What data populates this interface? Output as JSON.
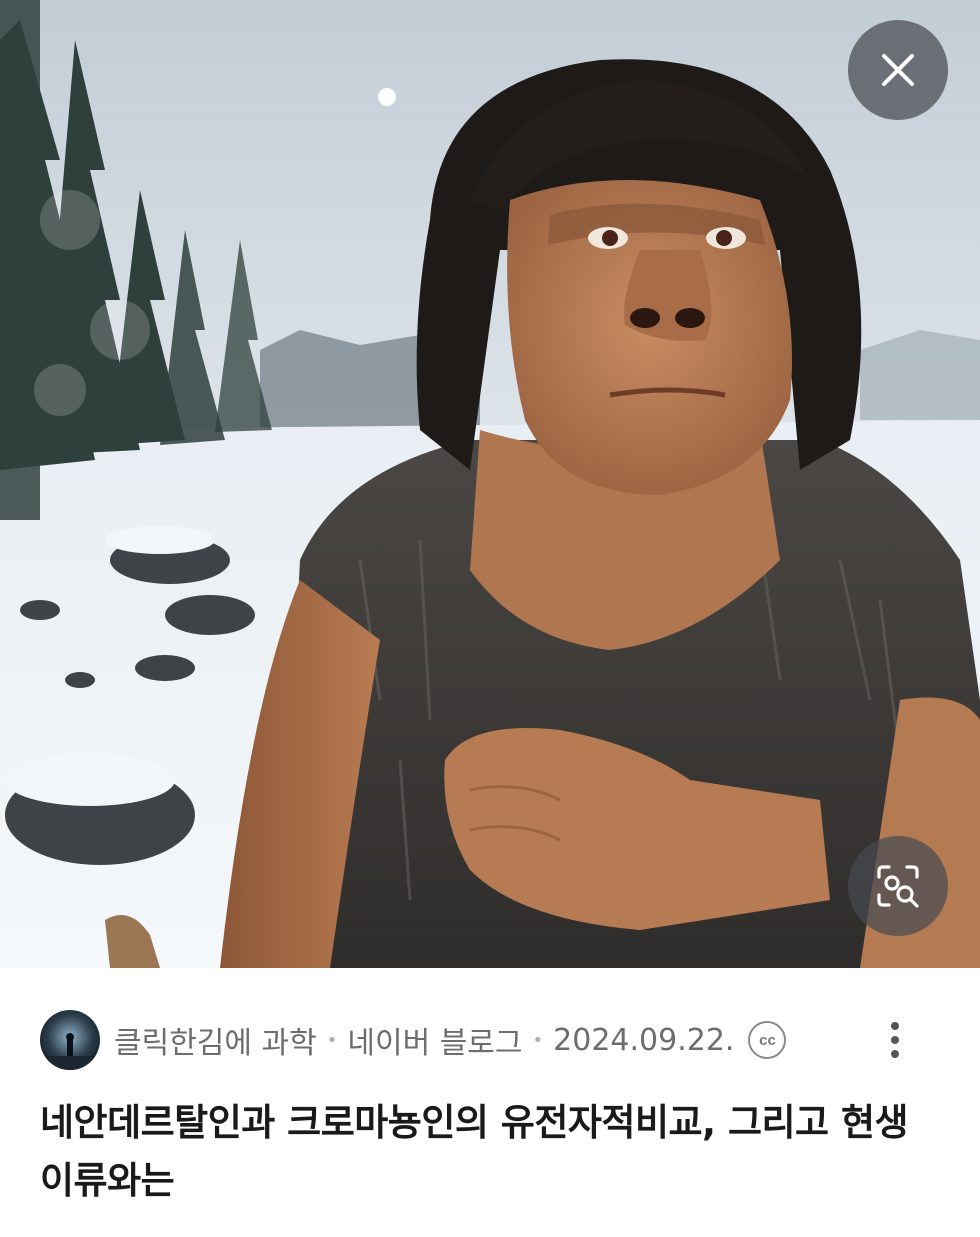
{
  "viewer": {
    "close_icon": "close-icon",
    "lens_icon": "image-search-icon"
  },
  "source": {
    "channel_name": "클릭한김에 과학",
    "separator": "•",
    "platform": "네이버 블로그",
    "date": "2024.09.22.",
    "license_badge": "cc"
  },
  "article": {
    "title": "네안데르탈인과 크로마뇽인의 유전자적비교, 그리고 현생이류와는"
  },
  "colors": {
    "overlay_button": "#464a50",
    "meta_text": "#6d6d6d",
    "title_text": "#1a1a1a"
  }
}
